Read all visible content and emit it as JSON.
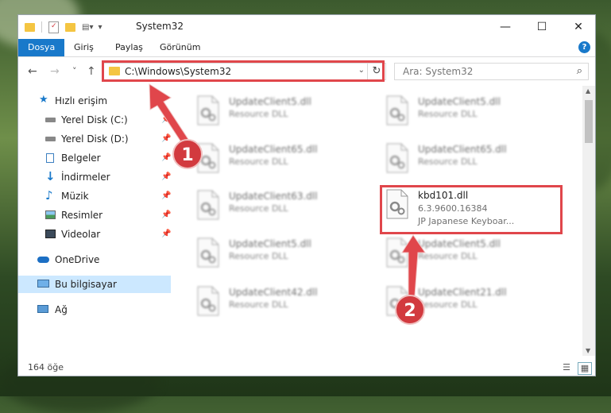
{
  "window": {
    "title": "System32"
  },
  "ribbon": {
    "tabs": [
      "Dosya",
      "Giriş",
      "Paylaş",
      "Görünüm"
    ],
    "help": "?"
  },
  "window_controls": {
    "minimize": "—",
    "maximize": "☐",
    "close": "✕"
  },
  "nav": {
    "back": "←",
    "forward": "→",
    "recent": "˅",
    "up": "↑"
  },
  "address": {
    "path": "C:\\Windows\\System32",
    "refresh": "↻",
    "dropdown": "⌄"
  },
  "search": {
    "placeholder": "Ara: System32",
    "icon": "search-icon"
  },
  "sidebar": {
    "quick_access": "Hızlı erişim",
    "items": [
      {
        "label": "Yerel Disk (C:)",
        "pinned": true
      },
      {
        "label": "Yerel Disk (D:)",
        "pinned": true
      },
      {
        "label": "Belgeler",
        "pinned": true
      },
      {
        "label": "İndirmeler",
        "pinned": true
      },
      {
        "label": "Müzik",
        "pinned": true
      },
      {
        "label": "Resimler",
        "pinned": true
      },
      {
        "label": "Videolar",
        "pinned": true
      }
    ],
    "onedrive": "OneDrive",
    "this_pc": "Bu bilgisayar",
    "network": "Ağ"
  },
  "files": {
    "left": [
      {
        "name": "UpdateClient5.dll",
        "type": "Resource DLL"
      },
      {
        "name": "UpdateClient65.dll",
        "type": "Resource DLL"
      },
      {
        "name": "UpdateClient63.dll",
        "type": "Resource DLL"
      },
      {
        "name": "UpdateClient5.dll",
        "type": "Resource DLL"
      },
      {
        "name": "UpdateClient42.dll",
        "type": "Resource DLL"
      }
    ],
    "right": [
      {
        "name": "UpdateClient5.dll",
        "type": "Resource DLL"
      },
      {
        "name": "UpdateClient65.dll",
        "type": "Resource DLL"
      },
      {
        "name": "UpdateClient5.dll",
        "type": "Resource DLL"
      },
      {
        "name": "UpdateClient21.dll",
        "type": "Resource DLL"
      }
    ],
    "highlight": {
      "name": "kbd101.dll",
      "version": "6.3.9600.16384",
      "description": "JP Japanese Keyboar..."
    }
  },
  "status": {
    "count": "164 öğe"
  },
  "annotations": {
    "step1": "1",
    "step2": "2",
    "color": "#e0464b"
  }
}
